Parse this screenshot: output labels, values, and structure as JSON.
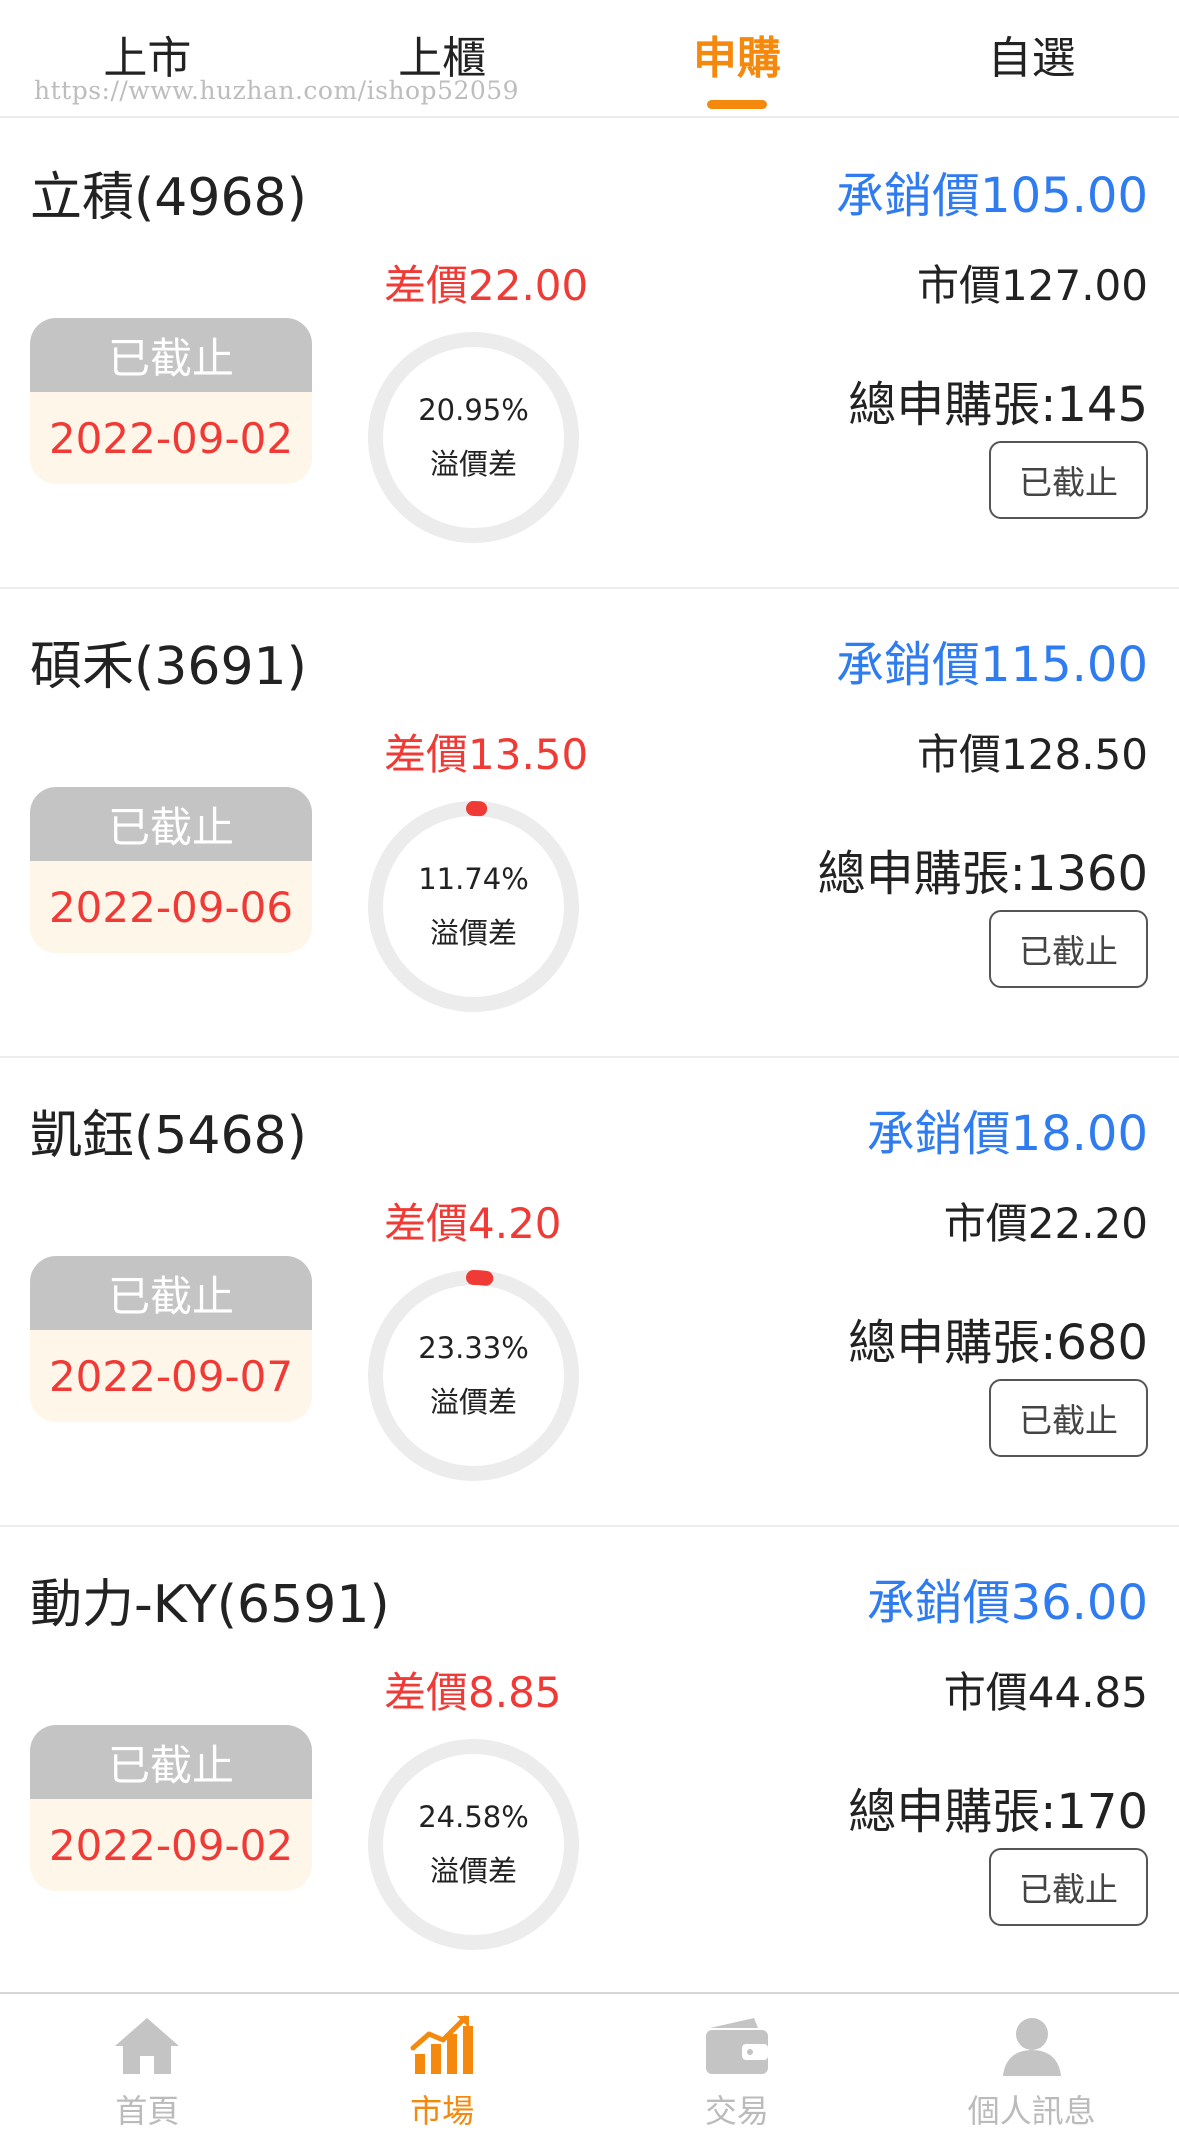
{
  "top_tabs": [
    {
      "label": "上市",
      "active": false
    },
    {
      "label": "上櫃",
      "active": false
    },
    {
      "label": "申購",
      "active": true
    },
    {
      "label": "自選",
      "active": false
    }
  ],
  "watermark": "https://www.huzhan.com/ishop52059",
  "items": [
    {
      "name": "立積(4968)",
      "underwriting_price": "承銷價105.00",
      "price_diff": "差價22.00",
      "market_price": "市價127.00",
      "status": "已截止",
      "date": "2022-09-02",
      "premium_pct": "20.95%",
      "premium_label": "溢價差",
      "ring_fraction": 0.0,
      "total_subscription": "總申購張:145",
      "button_label": "已截止"
    },
    {
      "name": "碩禾(3691)",
      "underwriting_price": "承銷價115.00",
      "price_diff": "差價13.50",
      "market_price": "市價128.50",
      "status": "已截止",
      "date": "2022-09-06",
      "premium_pct": "11.74%",
      "premium_label": "溢價差",
      "ring_fraction": 0.01,
      "total_subscription": "總申購張:1360",
      "button_label": "已截止"
    },
    {
      "name": "凱鈺(5468)",
      "underwriting_price": "承銷價18.00",
      "price_diff": "差價4.20",
      "market_price": "市價22.20",
      "status": "已截止",
      "date": "2022-09-07",
      "premium_pct": "23.33%",
      "premium_label": "溢價差",
      "ring_fraction": 0.02,
      "total_subscription": "總申購張:680",
      "button_label": "已截止"
    },
    {
      "name": "動力-KY(6591)",
      "underwriting_price": "承銷價36.00",
      "price_diff": "差價8.85",
      "market_price": "市價44.85",
      "status": "已截止",
      "date": "2022-09-02",
      "premium_pct": "24.58%",
      "premium_label": "溢價差",
      "ring_fraction": 0.0,
      "total_subscription": "總申購張:170",
      "button_label": "已截止"
    }
  ],
  "bottom_nav": [
    {
      "label": "首頁",
      "icon": "home-icon",
      "active": false
    },
    {
      "label": "市場",
      "icon": "market-chart-icon",
      "active": true
    },
    {
      "label": "交易",
      "icon": "wallet-icon",
      "active": false
    },
    {
      "label": "個人訊息",
      "icon": "user-icon",
      "active": false
    }
  ],
  "colors": {
    "accent": "#f5890d",
    "price_blue": "#2f7cf0",
    "alert_red": "#f03a36",
    "inactive_gray": "#c4c4c4",
    "ring_track": "#ececec",
    "date_bg": "#fff6ea"
  }
}
